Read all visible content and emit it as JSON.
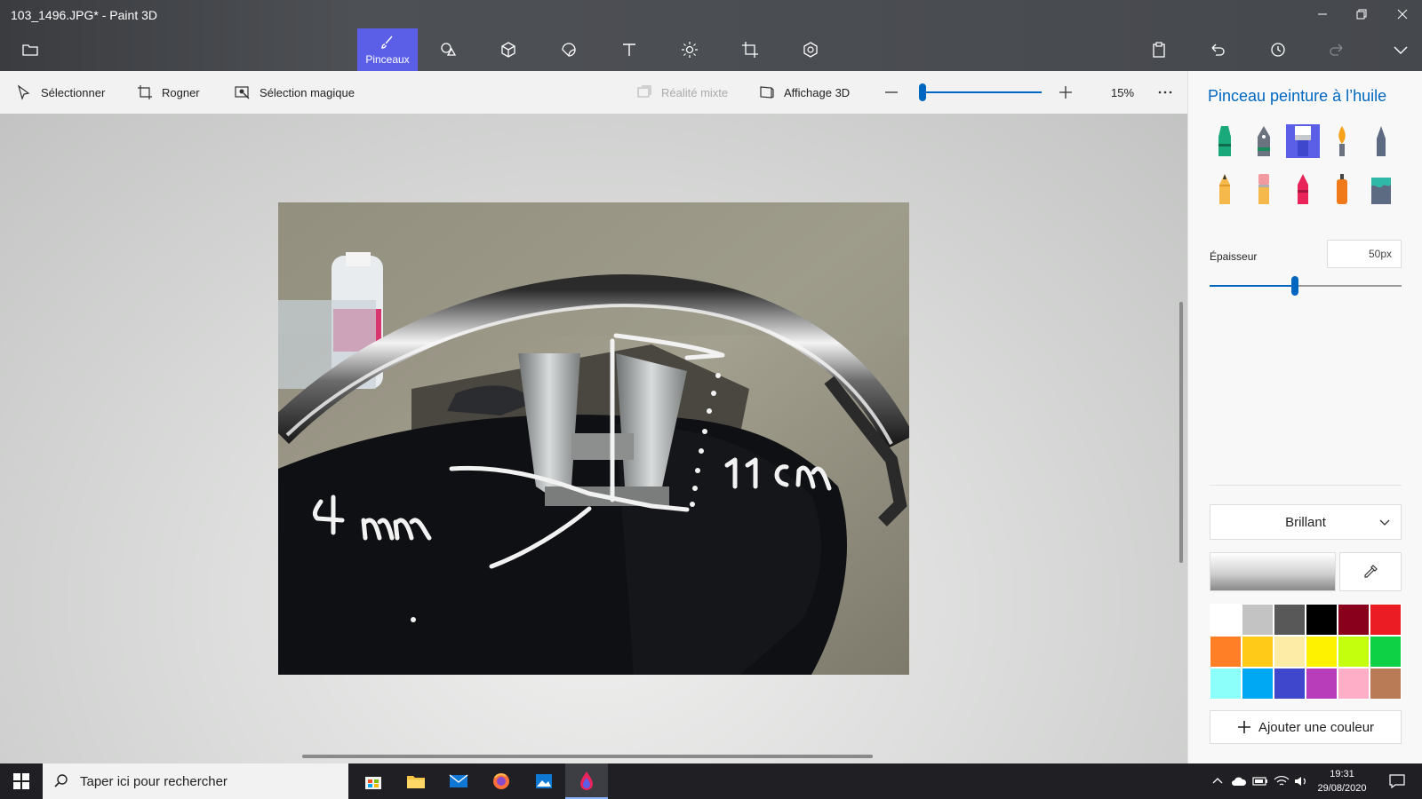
{
  "window": {
    "title": "103_1496.JPG* - Paint 3D",
    "controls": [
      "minimize-icon",
      "restore-icon",
      "close-icon"
    ]
  },
  "toolbar": {
    "active_tool_label": "Pinceaux",
    "tools": [
      "brushes-icon",
      "2d-shapes-icon",
      "3d-shapes-icon",
      "stickers-icon",
      "text-icon",
      "effects-icon",
      "canvas-icon",
      "3d-library-icon"
    ]
  },
  "subtoolbar": {
    "select": "Sélectionner",
    "crop": "Rogner",
    "magic_select": "Sélection magique",
    "mixed_reality": "Réalité mixte",
    "view_3d": "Affichage 3D",
    "zoom_value": "15%",
    "zoom_level": 0.15
  },
  "canvas": {
    "annotations": [
      "4 mm",
      "11cm"
    ]
  },
  "panel": {
    "title": "Pinceau peinture à l’huile",
    "thickness_label": "Épaisseur",
    "thickness_value": "50px",
    "thickness_level": 0.44,
    "finish": "Brillant",
    "add_color": "Ajouter une couleur",
    "brushes": [
      {
        "name": "marker",
        "color": "#1aa97a"
      },
      {
        "name": "calligraphy-pen",
        "color": "#1a8a5a"
      },
      {
        "name": "oil-brush",
        "color": "#ffffff"
      },
      {
        "name": "watercolor",
        "color": "#f7a21b"
      },
      {
        "name": "pixel-pen",
        "color": "#5d6b82"
      },
      {
        "name": "pencil",
        "color": "#f5b84a"
      },
      {
        "name": "eraser",
        "color": "#f29aa0"
      },
      {
        "name": "crayon",
        "color": "#e8245a"
      },
      {
        "name": "spray-can",
        "color": "#f07a1a"
      },
      {
        "name": "fill",
        "color": "#2fb8a8"
      }
    ],
    "palette": [
      "#ffffff",
      "#c3c3c3",
      "#585858",
      "#000000",
      "#88001b",
      "#ec1c24",
      "#ff7f27",
      "#ffca18",
      "#fdeca6",
      "#fff200",
      "#c4ff0e",
      "#0ed145",
      "#8cfffb",
      "#00a8f3",
      "#3f48cc",
      "#b83dba",
      "#ffaec8",
      "#b97a56"
    ]
  },
  "taskbar": {
    "search_placeholder": "Taper ici pour rechercher",
    "time": "19:31",
    "date": "29/08/2020",
    "apps": [
      "store-icon",
      "file-explorer-icon",
      "mail-icon",
      "firefox-icon",
      "photos-icon",
      "paint-3d-icon"
    ]
  }
}
